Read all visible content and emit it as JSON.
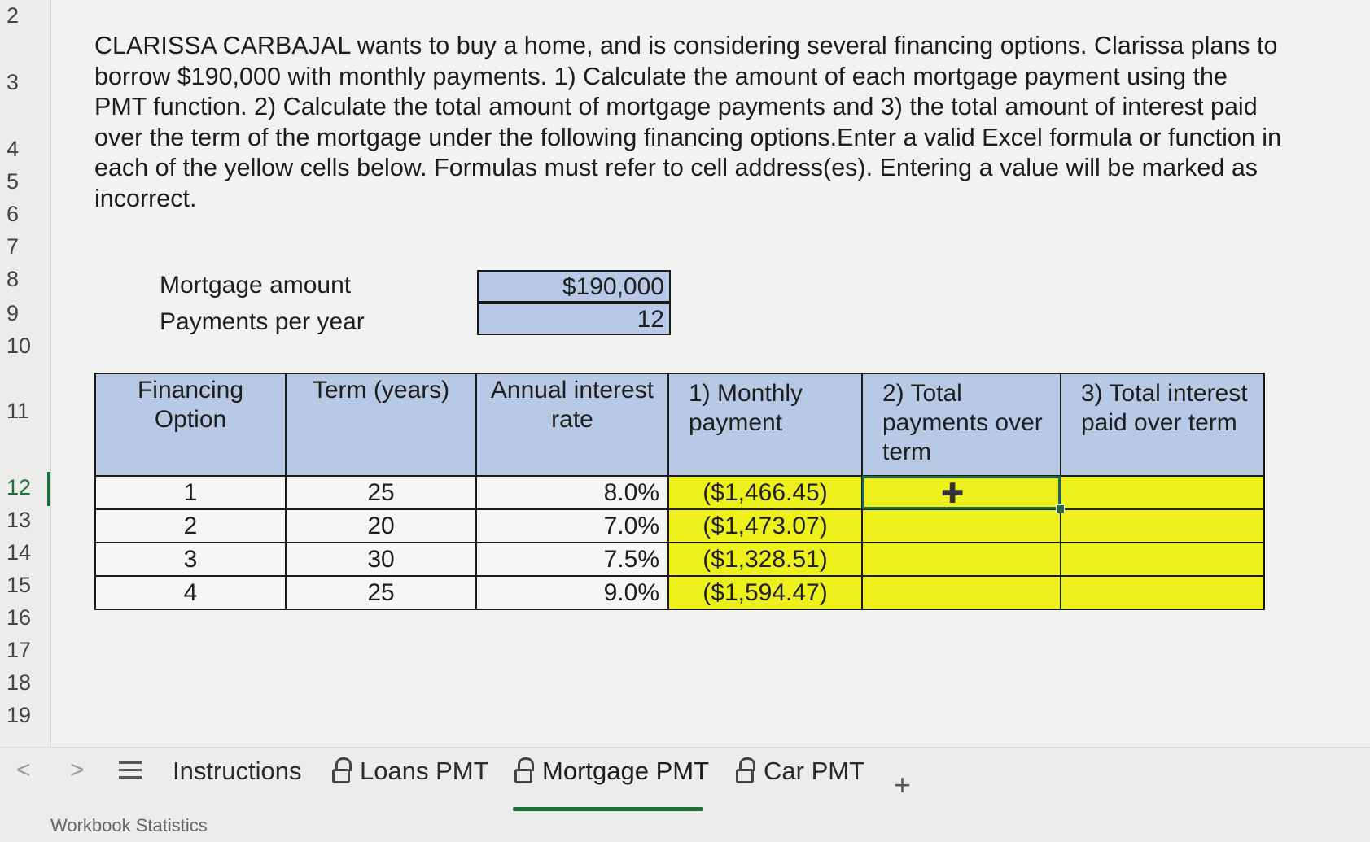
{
  "row_numbers": [
    "2",
    "3",
    "4",
    "5",
    "6",
    "7",
    "8",
    "9",
    "10",
    "11",
    "12",
    "13",
    "14",
    "15",
    "16",
    "17",
    "18",
    "19"
  ],
  "selected_row": "12",
  "instructions": "CLARISSA CARBAJAL wants to buy a home, and is considering several financing options.  Clarissa plans to borrow $190,000 with monthly payments.  1)  Calculate the amount of each mortgage payment using the PMT function.  2)  Calculate the total amount of mortgage payments and 3)  the total amount of interest paid over the term of the mortgage under the following financing options.Enter a valid Excel formula or function in each of the yellow cells below.  Formulas must refer to cell address(es).  Entering a value will be marked as incorrect.",
  "inputs": {
    "mortgage_label": "Mortgage amount",
    "mortgage_value": "$190,000",
    "payments_label": "Payments per year",
    "payments_value": "12"
  },
  "table": {
    "headers": [
      "Financing Option",
      "Term (years)",
      "Annual interest rate",
      "1)  Monthly payment",
      "2)  Total payments over term",
      "3)  Total interest paid over term"
    ],
    "rows": [
      [
        "1",
        "25",
        "8.0%",
        "($1,466.45)",
        "",
        ""
      ],
      [
        "2",
        "20",
        "7.0%",
        "($1,473.07)",
        "",
        ""
      ],
      [
        "3",
        "30",
        "7.5%",
        "($1,328.51)",
        "",
        ""
      ],
      [
        "4",
        "25",
        "9.0%",
        "($1,594.47)",
        "",
        ""
      ]
    ]
  },
  "colors": {
    "header_blue": "#b8c9e6",
    "input_yellow": "#eef01c",
    "selection_green": "#1d6e3a"
  },
  "tabs": [
    "Instructions",
    "Loans PMT",
    "Mortgage PMT",
    "Car PMT"
  ],
  "active_tab": "Mortgage PMT",
  "status_text": "Workbook Statistics"
}
